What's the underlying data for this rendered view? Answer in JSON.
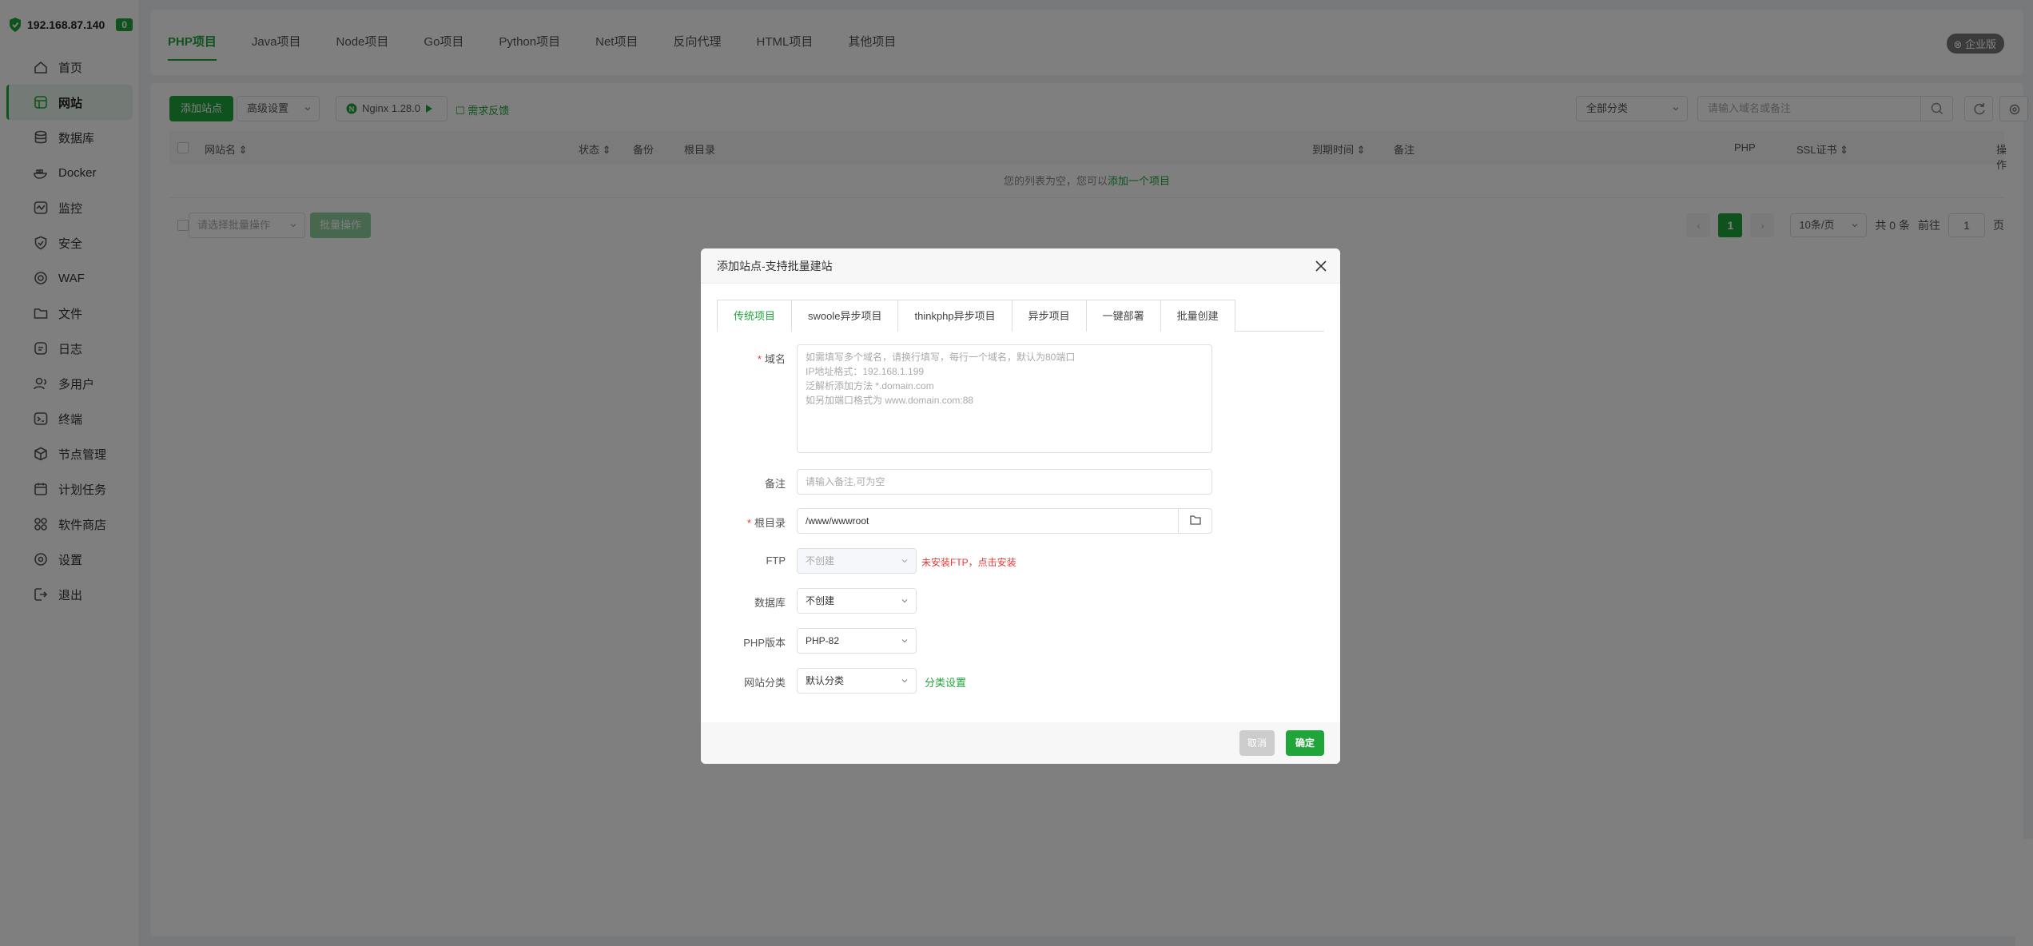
{
  "sidebar": {
    "ip": "192.168.87.140",
    "badge": "0",
    "items": [
      {
        "label": "首页",
        "icon": "home-icon"
      },
      {
        "label": "网站",
        "icon": "website-icon",
        "active": true
      },
      {
        "label": "数据库",
        "icon": "database-icon"
      },
      {
        "label": "Docker",
        "icon": "docker-icon"
      },
      {
        "label": "监控",
        "icon": "monitor-icon"
      },
      {
        "label": "安全",
        "icon": "shield-icon"
      },
      {
        "label": "WAF",
        "icon": "waf-icon"
      },
      {
        "label": "文件",
        "icon": "folder-icon"
      },
      {
        "label": "日志",
        "icon": "log-icon"
      },
      {
        "label": "多用户",
        "icon": "users-icon"
      },
      {
        "label": "终端",
        "icon": "terminal-icon"
      },
      {
        "label": "节点管理",
        "icon": "node-icon"
      },
      {
        "label": "计划任务",
        "icon": "calendar-icon"
      },
      {
        "label": "软件商店",
        "icon": "apps-icon"
      },
      {
        "label": "设置",
        "icon": "gear-icon"
      },
      {
        "label": "退出",
        "icon": "logout-icon"
      }
    ]
  },
  "header": {
    "tabs": [
      "PHP项目",
      "Java项目",
      "Node项目",
      "Go项目",
      "Python项目",
      "Net项目",
      "反向代理",
      "HTML项目",
      "其他项目"
    ],
    "edition": "企业版"
  },
  "toolbar": {
    "add_site": "添加站点",
    "advanced": "高级设置",
    "nginx": "Nginx 1.28.0",
    "feedback": "需求反馈",
    "category": "全部分类",
    "search_placeholder": "请输入域名或备注"
  },
  "table": {
    "headers": {
      "name": "网站名 ⇕",
      "status": "状态 ⇕",
      "backup": "备份",
      "root": "根目录",
      "expire": "到期时间 ⇕",
      "note": "备注",
      "php": "PHP",
      "ssl": "SSL证书 ⇕",
      "ops": "操作"
    },
    "empty_text": "您的列表为空，您可以",
    "empty_link": "添加一个项目"
  },
  "footer": {
    "batch_placeholder": "请选择批量操作",
    "batch_button": "批量操作",
    "prev": "‹",
    "page": "1",
    "next": "›",
    "page_size": "10条/页",
    "total": "共 0 条",
    "goto_label": "前往",
    "goto_value": "1",
    "page_suffix": "页"
  },
  "dialog": {
    "title": "添加站点-支持批量建站",
    "tabs": [
      "传统项目",
      "swoole异步项目",
      "thinkphp异步项目",
      "异步项目",
      "一键部署",
      "批量创建"
    ],
    "domain_label": "域名",
    "domain_placeholder": [
      "如需填写多个域名，请换行填写，每行一个域名，默认为80端口",
      "IP地址格式：192.168.1.199",
      "泛解析添加方法 *.domain.com",
      "如另加端口格式为 www.domain.com:88"
    ],
    "note_label": "备注",
    "note_placeholder": "请输入备注,可为空",
    "root_label": "根目录",
    "root_value": "/www/wwwroot",
    "ftp_label": "FTP",
    "ftp_value": "不创建",
    "ftp_warning": "未安装FTP，点击安装",
    "db_label": "数据库",
    "db_value": "不创建",
    "php_label": "PHP版本",
    "php_value": "PHP-82",
    "category_label": "网站分类",
    "category_value": "默认分类",
    "category_link": "分类设置",
    "cancel": "取消",
    "confirm": "确定"
  },
  "colors": {
    "accent": "#20a53a",
    "warning": "#e53935",
    "overlay": "rgba(0,0,0,0.5)"
  }
}
